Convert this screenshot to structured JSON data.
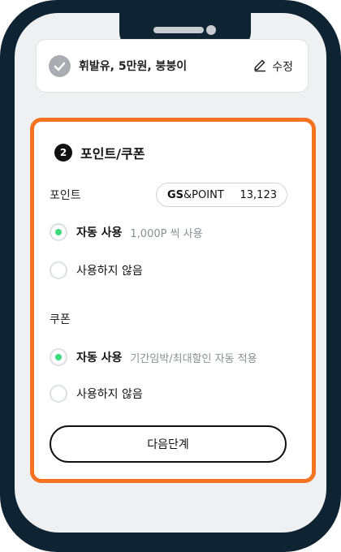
{
  "summary": {
    "text": "휘발유, 5만원, 붕붕이",
    "edit_label": "수정"
  },
  "step": {
    "number": "2",
    "title": "포인트/쿠폰"
  },
  "points": {
    "label": "포인트",
    "brand_bold": "GS",
    "brand_rest": "&POINT",
    "balance": "13,123",
    "options": [
      {
        "label": "자동 사용",
        "desc": "1,000P 씩 사용",
        "selected": true
      },
      {
        "label": "사용하지 않음",
        "desc": "",
        "selected": false
      }
    ]
  },
  "coupon": {
    "label": "쿠폰",
    "options": [
      {
        "label": "자동 사용",
        "desc": "기간임박/최대할인 자동 적용",
        "selected": true
      },
      {
        "label": "사용하지 않음",
        "desc": "",
        "selected": false
      }
    ]
  },
  "next_button": "다음단계",
  "colors": {
    "accent": "#f37321",
    "selected": "#3dd97b",
    "bezel": "#0f2433"
  },
  "icons": {
    "check": "check-circle-icon",
    "edit": "pencil-icon"
  }
}
